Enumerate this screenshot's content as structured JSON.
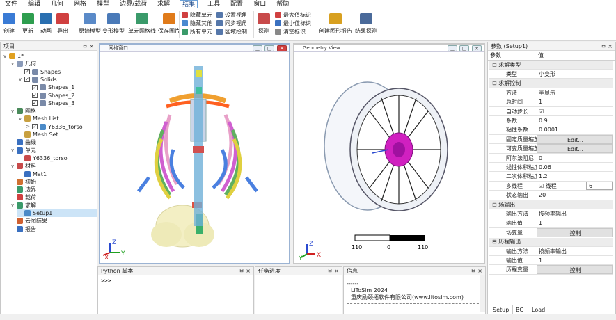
{
  "menu": [
    "文件",
    "编辑",
    "几何",
    "网格",
    "模型",
    "边界/载荷",
    "求解",
    "结果",
    "工具",
    "配置",
    "窗口",
    "帮助"
  ],
  "menu_active": "结果",
  "ribbon": {
    "big": [
      {
        "label": "创建",
        "icon": "create-icon",
        "color": "#3a7bd5"
      },
      {
        "label": "更新",
        "icon": "update-icon",
        "color": "#2e9e4f"
      },
      {
        "label": "动画",
        "icon": "animation-icon",
        "color": "#2a6fb0"
      },
      {
        "label": "导出",
        "icon": "export-icon",
        "color": "#d04040"
      },
      {
        "label": "原始模型",
        "icon": "original-model-icon",
        "color": "#5a8ac8"
      },
      {
        "label": "变形模型",
        "icon": "deformed-model-icon",
        "color": "#4a7ab8"
      },
      {
        "label": "单元网格线",
        "icon": "element-mesh-icon",
        "color": "#3a9a6a"
      },
      {
        "label": "保存图片",
        "icon": "save-image-icon",
        "color": "#e07b1a"
      },
      {
        "label": "探测",
        "icon": "probe-icon",
        "color": "#c84a4a"
      },
      {
        "label": "创建图形报告",
        "icon": "create-graph-report-icon",
        "color": "#d8a020"
      },
      {
        "label": "结果探测",
        "icon": "result-probe-icon",
        "color": "#4a6a9a"
      }
    ],
    "small1": [
      {
        "label": "隐藏单元",
        "color": "#d04040"
      },
      {
        "label": "隐藏其他",
        "color": "#4a8ad0"
      },
      {
        "label": "所有单元",
        "color": "#3a9a6a"
      }
    ],
    "small2": [
      {
        "label": "设置视角",
        "color": "#5577aa"
      },
      {
        "label": "同步视角",
        "color": "#5577aa"
      },
      {
        "label": "区域绘制",
        "color": "#5577aa"
      }
    ],
    "small3": [
      {
        "label": "最大值标识",
        "color": "#d04040"
      },
      {
        "label": "最小值标识",
        "color": "#3a70c0"
      },
      {
        "label": "清空标识",
        "color": "#888888"
      }
    ]
  },
  "project": {
    "title": "项目",
    "ctl": "ㅂ ×",
    "tree": [
      {
        "label": "1*",
        "depth": 0,
        "exp": "∨",
        "icon": "project-icon",
        "color": "#e0a020"
      },
      {
        "label": "几何",
        "depth": 1,
        "exp": "∨",
        "icon": "geometry-icon",
        "color": "#8a9ab8"
      },
      {
        "label": "Shapes",
        "depth": 2,
        "check": true,
        "icon": "shape-icon",
        "color": "#7a8aa8"
      },
      {
        "label": "Solids",
        "depth": 2,
        "exp": "∨",
        "check": true,
        "icon": "solid-icon",
        "color": "#7a8aa8"
      },
      {
        "label": "Shapes_1",
        "depth": 3,
        "check": true,
        "icon": "shape-icon",
        "color": "#7a8aa8"
      },
      {
        "label": "Shapes_2",
        "depth": 3,
        "check": true,
        "icon": "shape-icon",
        "color": "#7a8aa8"
      },
      {
        "label": "Shapes_3",
        "depth": 3,
        "check": true,
        "icon": "shape-icon",
        "color": "#7a8aa8"
      },
      {
        "label": "网格",
        "depth": 1,
        "exp": "∨",
        "icon": "mesh-icon",
        "color": "#4a8a5a"
      },
      {
        "label": "Mesh List",
        "depth": 2,
        "exp": "∨",
        "icon": "mesh-list-icon",
        "color": "#c8a040"
      },
      {
        "label": "Y6336_torso",
        "depth": 3,
        "exp": ">",
        "check": true,
        "icon": "mesh-item-icon",
        "color": "#4a8ac8"
      },
      {
        "label": "Mesh Set",
        "depth": 2,
        "icon": "mesh-set-icon",
        "color": "#c8a040"
      },
      {
        "label": "曲线",
        "depth": 1,
        "icon": "curve-icon",
        "color": "#3a70c0"
      },
      {
        "label": "单元",
        "depth": 1,
        "exp": "∨",
        "icon": "element-icon",
        "color": "#3a70c0"
      },
      {
        "label": "Y6336_torso",
        "depth": 2,
        "icon": "element-set-icon",
        "color": "#c84a4a"
      },
      {
        "label": "材料",
        "depth": 1,
        "exp": "∨",
        "icon": "material-icon",
        "color": "#c84a4a"
      },
      {
        "label": "Mat1",
        "depth": 2,
        "icon": "material-item-icon",
        "color": "#3a70c0"
      },
      {
        "label": "初始",
        "depth": 1,
        "icon": "initial-icon",
        "color": "#d07030"
      },
      {
        "label": "边界",
        "depth": 1,
        "icon": "boundary-icon",
        "color": "#3a9a6a"
      },
      {
        "label": "载荷",
        "depth": 1,
        "icon": "load-icon",
        "color": "#d04040"
      },
      {
        "label": "求解",
        "depth": 1,
        "exp": "∨",
        "icon": "solve-icon",
        "color": "#3a9a6a"
      },
      {
        "label": "Setup1",
        "depth": 2,
        "icon": "setup-icon",
        "color": "#4a8ac8",
        "selected": true
      },
      {
        "label": "云图结果",
        "depth": 1,
        "icon": "contour-result-icon",
        "color": "#d06030"
      },
      {
        "label": "报告",
        "depth": 1,
        "icon": "report-icon",
        "color": "#3a70c0"
      }
    ]
  },
  "viewport_left": {
    "title": "网格窗口"
  },
  "viewport_right": {
    "title": "Geometry View"
  },
  "scalebar": {
    "left": "110",
    "mid": "0",
    "right": "110"
  },
  "axis": {
    "x": "X",
    "y": "Y",
    "z": "Z"
  },
  "python": {
    "title": "Python 脚本",
    "ctl": "ㅂ ×",
    "prompt": ">>>"
  },
  "task": {
    "title": "任务进度",
    "ctl": "ㅂ ×"
  },
  "info": {
    "title": "信息",
    "ctl": "ㅂ ×",
    "dash": "------",
    "line1": "LiToSim 2024",
    "line2": "重庆励颐拓软件有限公司(www.litosim.com)"
  },
  "params": {
    "title": "参数 (Setup1)",
    "ctl": "ㅂ ×",
    "head_key": "参数",
    "head_val": "值",
    "rows": [
      {
        "grp": true,
        "k": "求解类型"
      },
      {
        "k": "类型",
        "v": "小变形"
      },
      {
        "grp": true,
        "k": "求解控制"
      },
      {
        "k": "方法",
        "v": "半显示"
      },
      {
        "k": "总时间",
        "v": "1"
      },
      {
        "k": "自动步长",
        "v": "☑"
      },
      {
        "k": "系数",
        "v": "0.9"
      },
      {
        "k": "粘性系数",
        "v": "0.0001"
      },
      {
        "k": "固定质量缩放",
        "v": "Edit...",
        "btn": true
      },
      {
        "k": "可变质量缩放",
        "v": "Edit...",
        "btn": true
      },
      {
        "k": "阿尔法阻尼",
        "v": "0"
      },
      {
        "k": "线性体积粘度",
        "v": "0.06"
      },
      {
        "k": "二次体积粘度",
        "v": "1.2"
      },
      {
        "k": "多线程",
        "v": "☑ 线程",
        "extra": "6"
      },
      {
        "k": "状态输出",
        "v": "20"
      },
      {
        "grp": true,
        "k": "场输出"
      },
      {
        "k": "输出方法",
        "v": "按频率输出"
      },
      {
        "k": "输出值",
        "v": "1"
      },
      {
        "k": "场变量",
        "v": "控制",
        "btn": true
      },
      {
        "grp": true,
        "k": "历程输出"
      },
      {
        "k": "输出方法",
        "v": "按频率输出"
      },
      {
        "k": "输出值",
        "v": "1"
      },
      {
        "k": "历程变量",
        "v": "控制",
        "btn": true
      }
    ],
    "tabs": [
      "Setup",
      "BC",
      "Load"
    ]
  },
  "colors": {
    "accent": "#9bb3d3",
    "selected": "#cce4f7",
    "rim_hub": "#d020c0"
  }
}
